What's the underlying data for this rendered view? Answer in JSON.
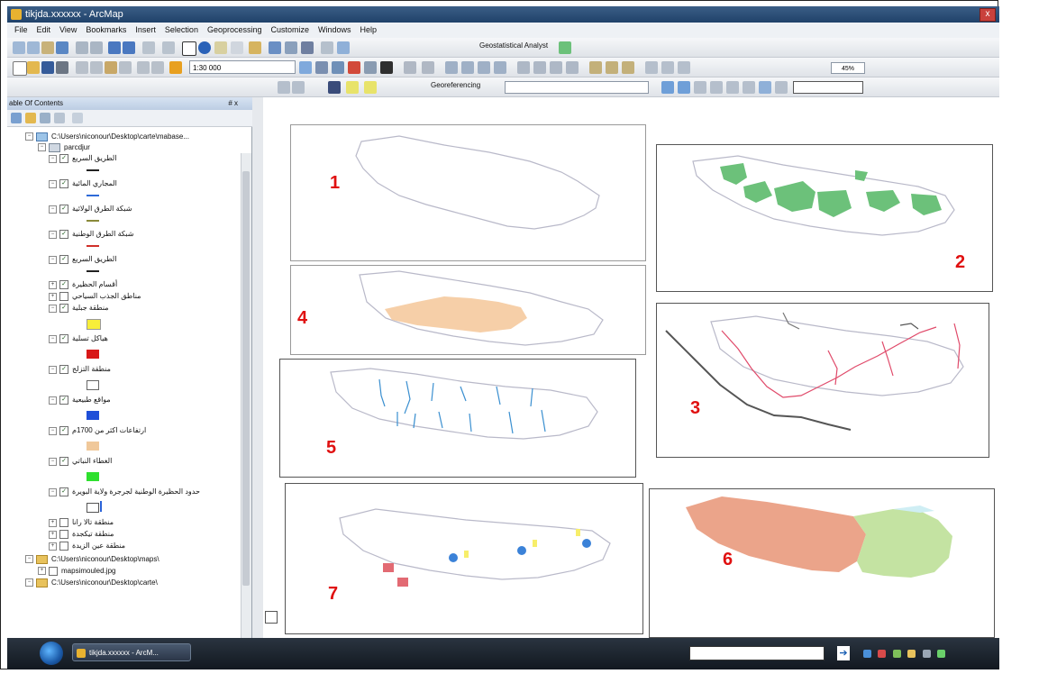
{
  "window": {
    "title": "tikjda.xxxxxx - ArcMap",
    "close_label": "x"
  },
  "menu": [
    "File",
    "Edit",
    "View",
    "Bookmarks",
    "Insert",
    "Selection",
    "Geoprocessing",
    "Customize",
    "Windows",
    "Help"
  ],
  "toolbar": {
    "scale": "1:30 000",
    "geostatistical": "Geostatistical Analyst",
    "georeferencing": "Georeferencing",
    "zoom_percent": "45%"
  },
  "toc": {
    "title": "able Of Contents",
    "pin": "# x",
    "rows": [
      {
        "type": "data-frame",
        "label": "C:\\Users\\niconour\\Desktop\\carte\\mabase..."
      },
      {
        "type": "group",
        "label": "parcdjur"
      },
      {
        "type": "layer",
        "label": "الطريق السريع",
        "checked": true
      },
      {
        "type": "layer",
        "label": "المجاري المائية",
        "checked": true
      },
      {
        "type": "layer",
        "label": "شبكة الطرق الولائية",
        "checked": true
      },
      {
        "type": "layer",
        "label": "شبكة الطرق الوطنية",
        "checked": true
      },
      {
        "type": "layer",
        "label": "الطريق السريع",
        "checked": true
      },
      {
        "type": "layer",
        "label": "أقسام الحظيرة",
        "checked": true
      },
      {
        "type": "layer",
        "label": "مناطق الجذب السياحي",
        "checked": false
      },
      {
        "type": "layer",
        "label": "منطقة جبلية",
        "checked": true
      },
      {
        "type": "layer",
        "label": "هياكل تسلية",
        "checked": true
      },
      {
        "type": "layer",
        "label": "منطقة التزلج",
        "checked": true
      },
      {
        "type": "layer",
        "label": "مواقع طبيعية",
        "checked": true
      },
      {
        "type": "layer",
        "label": "ارتفاعات اكثر من 1700م",
        "checked": true
      },
      {
        "type": "layer",
        "label": "الغطاء النباتي",
        "checked": true
      },
      {
        "type": "layer",
        "label": "حدود الحظيرة الوطنية لجرجرة ولاية البويرة",
        "checked": true
      },
      {
        "type": "layer",
        "label": "منطقة تالا رانا",
        "checked": false
      },
      {
        "type": "layer",
        "label": "منطقة تيكجدة",
        "checked": false
      },
      {
        "type": "layer",
        "label": "منطقة عين الزيدة",
        "checked": false
      },
      {
        "type": "data-frame",
        "label": "C:\\Users\\niconour\\Desktop\\maps\\"
      },
      {
        "type": "layer",
        "label": "mapsimouled.jpg",
        "checked": false
      },
      {
        "type": "data-frame",
        "label": "C:\\Users\\niconour\\Desktop\\carte\\"
      }
    ]
  },
  "maps": {
    "labels": [
      "1",
      "2",
      "3",
      "4",
      "5",
      "6",
      "7"
    ]
  },
  "taskbar": {
    "app_button": "tikjda.xxxxxx - ArcM..."
  },
  "colors": {
    "vegetation": "#6cc17a",
    "elevation": "#f6cfa8",
    "roads": "#e04a6a",
    "highway": "#555555",
    "rivers": "#3a8fd0",
    "zone_a": "#eba48a",
    "zone_b": "#c4e3a2",
    "zone_c": "#cfeef4",
    "leisure": "#e26a73",
    "natural_sites": "#3b82d8",
    "mountain": "#f7ee6a",
    "map_numbers": "#e01010"
  }
}
